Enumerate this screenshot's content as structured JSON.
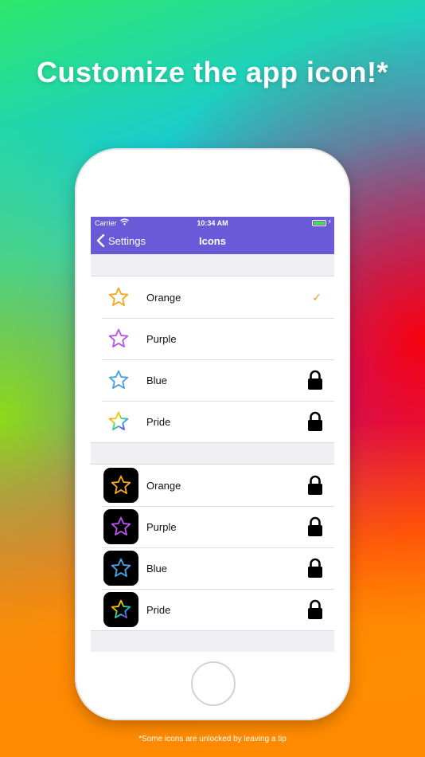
{
  "headline": "Customize the app icon!*",
  "footnote": "*Some icons are unlocked by leaving a tip",
  "status_bar": {
    "carrier": "Carrier",
    "time": "10:34 AM"
  },
  "nav": {
    "back_label": "Settings",
    "title": "Icons"
  },
  "sections": [
    {
      "style": "outline",
      "rows": [
        {
          "label": "Orange",
          "color": "#f5a623",
          "state": "selected"
        },
        {
          "label": "Purple",
          "color": "#b455e8",
          "state": "unlocked"
        },
        {
          "label": "Blue",
          "color": "#4aa3df",
          "state": "locked"
        },
        {
          "label": "Pride",
          "color": "rainbow",
          "state": "locked"
        }
      ]
    },
    {
      "style": "dark-tile",
      "rows": [
        {
          "label": "Orange",
          "color": "#f5a623",
          "state": "locked"
        },
        {
          "label": "Purple",
          "color": "#b455e8",
          "state": "locked"
        },
        {
          "label": "Blue",
          "color": "#4aa3df",
          "state": "locked"
        },
        {
          "label": "Pride",
          "color": "rainbow",
          "state": "locked"
        }
      ]
    }
  ],
  "colors": {
    "nav_bar": "#6a5ad8",
    "check": "#f29a1e"
  },
  "icons": {
    "selected": "checkmark-icon",
    "locked": "lock-icon",
    "row": "star-icon"
  }
}
